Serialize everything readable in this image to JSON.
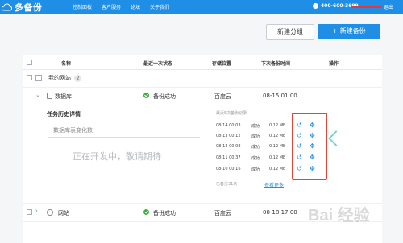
{
  "topbar": {
    "logo_text": "多备份",
    "nav": [
      "控制面板",
      "客户服务",
      "论坛",
      "关于我们"
    ],
    "phone": "400-600-3699",
    "logout": "退出"
  },
  "toolbar": {
    "new_group": "新建分组",
    "new_backup": "+ 新建备份"
  },
  "table": {
    "headers": {
      "name": "名称",
      "last_status": "最近一次状态",
      "storage": "存储位置",
      "next_time": "下次备份时间",
      "actions": "操作"
    },
    "group": {
      "name": "我的网站",
      "count": "2"
    },
    "rows": [
      {
        "name": "数据库",
        "status": "备份成功",
        "storage": "百度云",
        "next": "08-15 01:00"
      },
      {
        "name": "网站",
        "status": "备份成功",
        "storage": "百度云",
        "next": "08-18 17:00"
      }
    ]
  },
  "detail": {
    "task_title": "任务历史详情",
    "select_placeholder": "数据库表变化数",
    "dev_message": "正在开发中，敬请期待",
    "history_head": "最近5次备份记录",
    "history": [
      {
        "time": "08-14 00:03",
        "status": "成功",
        "size": "0.12 MB"
      },
      {
        "time": "08-13 00:12",
        "status": "成功",
        "size": "0.12 MB"
      },
      {
        "time": "08-12 00:08",
        "status": "成功",
        "size": "0.12 MB"
      },
      {
        "time": "08-11 00:37",
        "status": "成功",
        "size": "0.12 MB"
      },
      {
        "time": "08-10 00:16",
        "status": "成功",
        "size": "0.12 MB"
      }
    ],
    "total": "已备份31次",
    "more": "查看更多"
  },
  "watermark": {
    "text": "Bai 经验"
  },
  "colors": {
    "brand": "#1f8ee6",
    "success": "#3cae3c",
    "highlight": "#d94a3a",
    "accent_teal": "#7fd0d8"
  }
}
